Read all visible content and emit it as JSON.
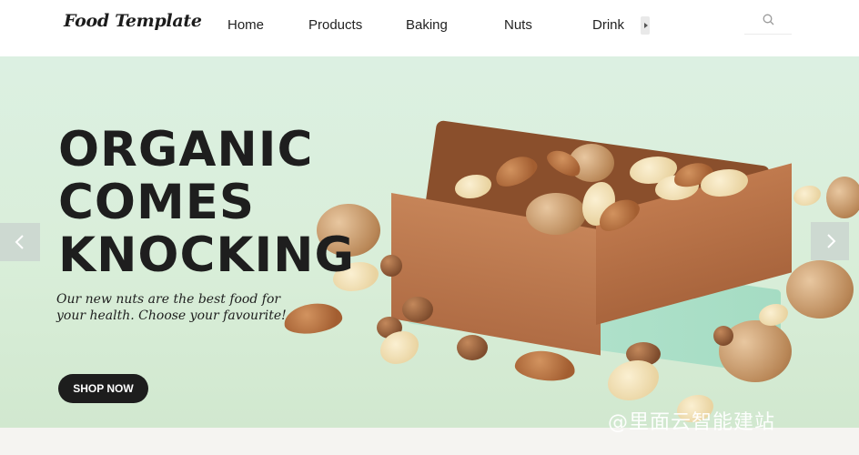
{
  "brand": {
    "name": "Food Template"
  },
  "nav": {
    "items": [
      "Home",
      "Products",
      "Baking",
      "Nuts",
      "Drink"
    ]
  },
  "hero": {
    "title_lines": [
      "ORGANIC",
      "COMES",
      "KNOCKING"
    ],
    "subtitle": "Our new nuts are the best food for your health. Choose your favourite!",
    "cta_label": "SHOP NOW"
  },
  "watermark": "@里面云智能建站",
  "colors": {
    "accent": "#1d1d1d",
    "hero_bg": "#d9eed9"
  },
  "icons": {
    "search": "search-icon",
    "prev": "chevron-left-icon",
    "next": "chevron-right-icon",
    "more": "caret-right-icon"
  }
}
